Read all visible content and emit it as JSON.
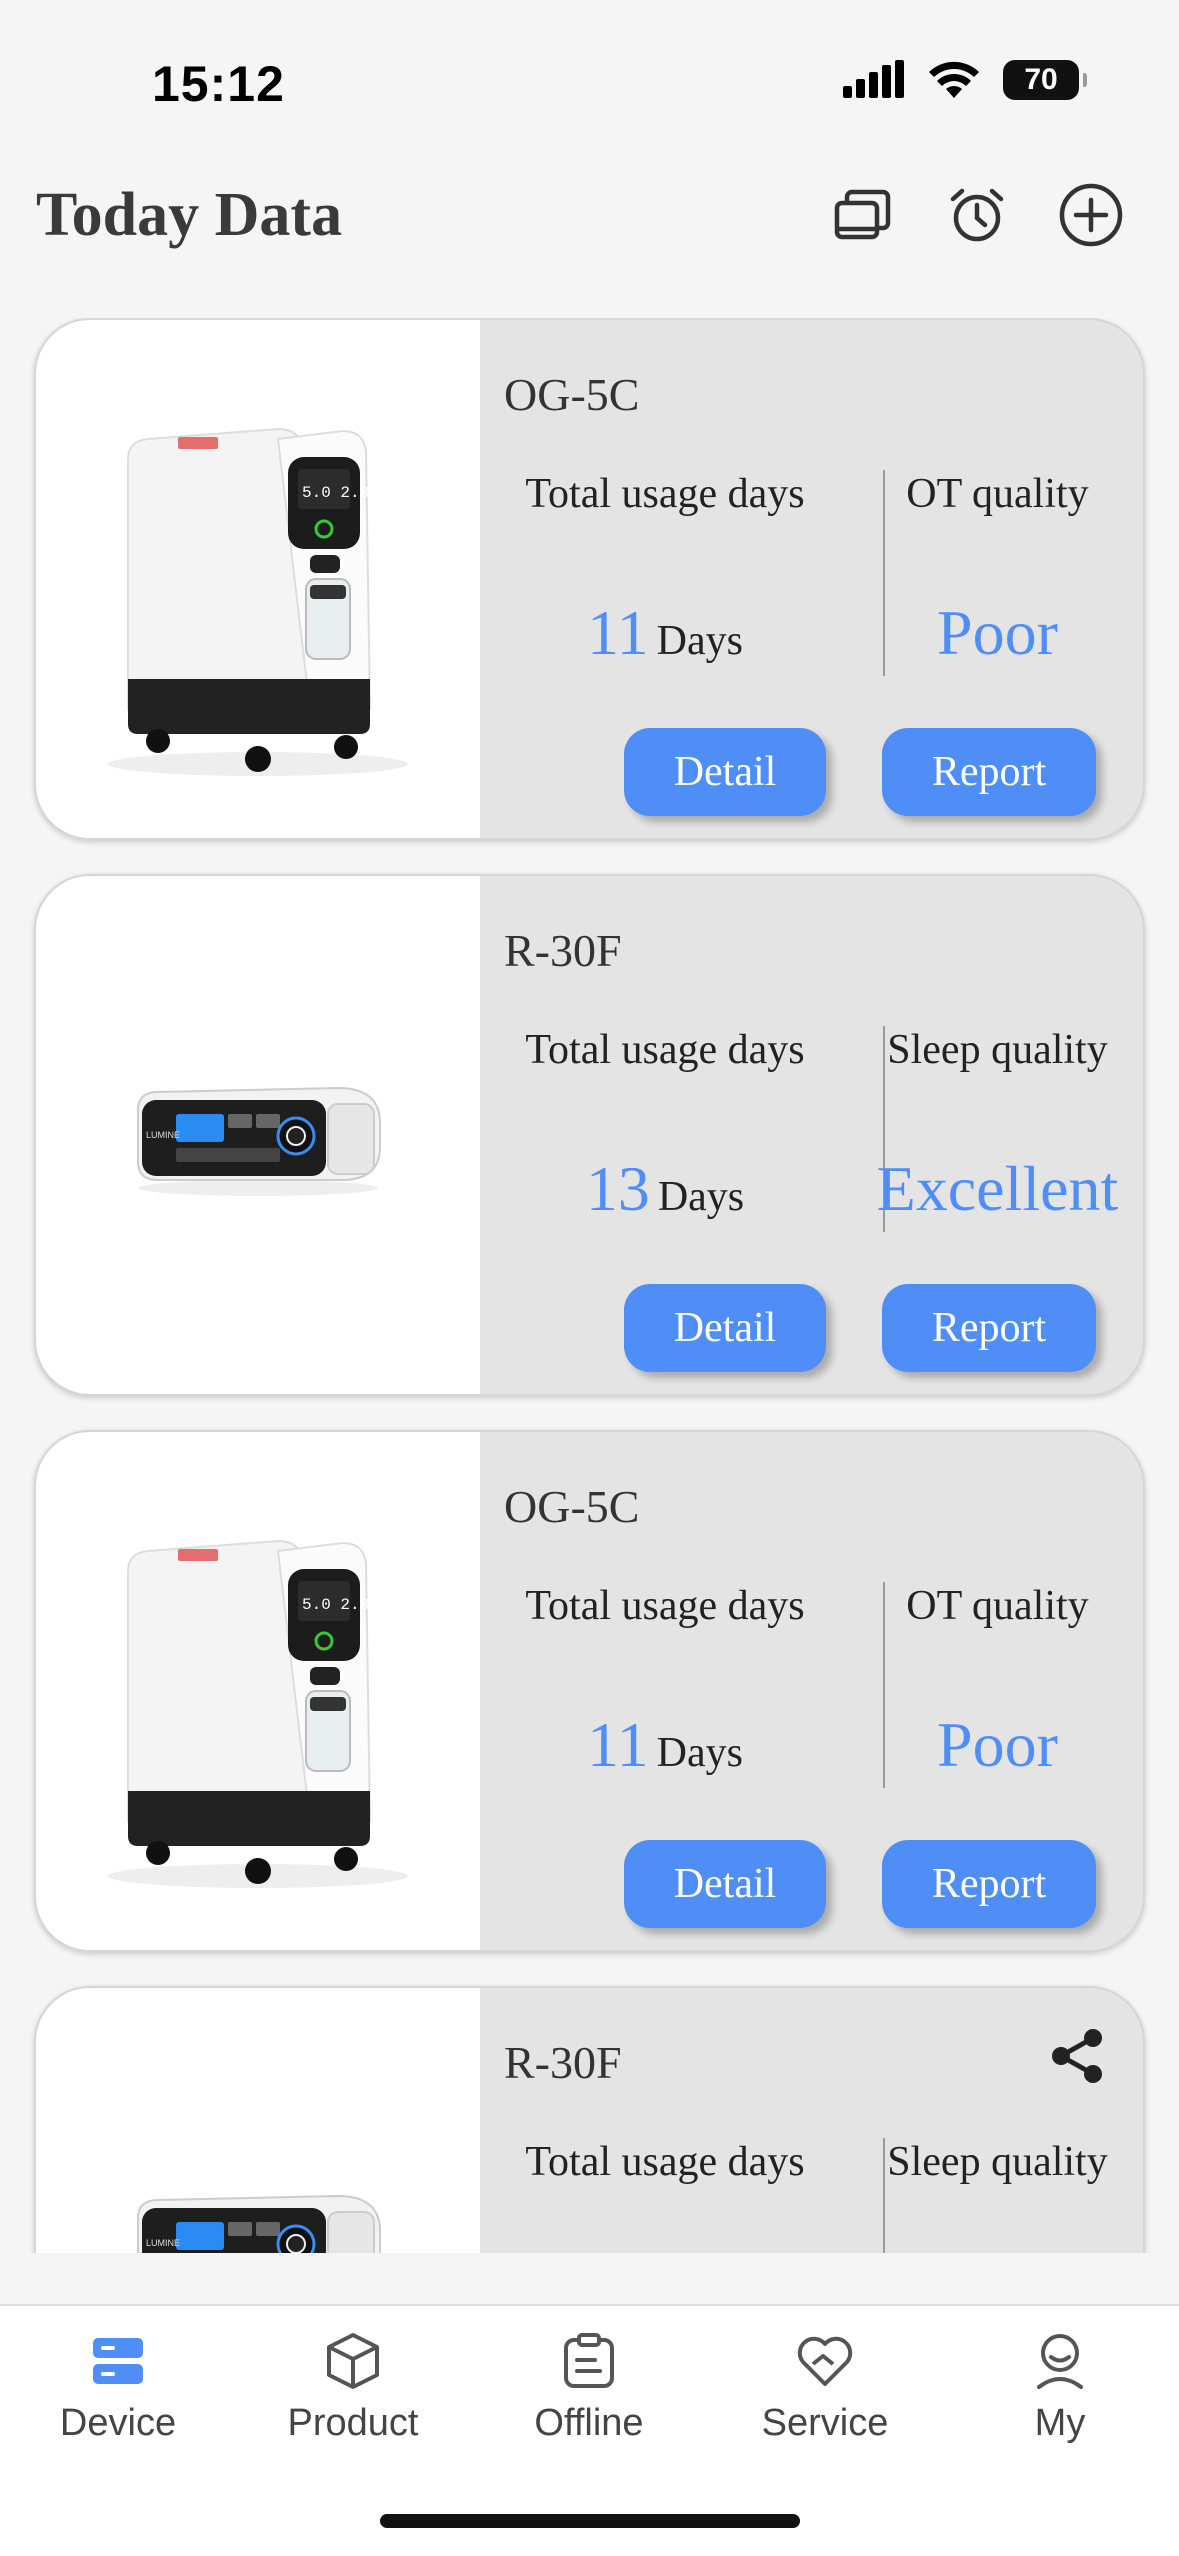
{
  "status": {
    "time": "15:12",
    "battery": "70"
  },
  "header": {
    "title": "Today Data"
  },
  "cards": [
    {
      "model": "OG-5C",
      "usage_label": "Total usage days",
      "quality_label": "OT quality",
      "days": "11",
      "days_unit": "Days",
      "quality": "Poor",
      "detail": "Detail",
      "report": "Report",
      "device": "oxygen-concentrator"
    },
    {
      "model": "R-30F",
      "usage_label": "Total usage days",
      "quality_label": "Sleep quality",
      "days": "13",
      "days_unit": "Days",
      "quality": "Excellent",
      "detail": "Detail",
      "report": "Report",
      "device": "cpap"
    },
    {
      "model": "OG-5C",
      "usage_label": "Total usage days",
      "quality_label": "OT quality",
      "days": "11",
      "days_unit": "Days",
      "quality": "Poor",
      "detail": "Detail",
      "report": "Report",
      "device": "oxygen-concentrator"
    },
    {
      "model": "R-30F",
      "usage_label": "Total usage days",
      "quality_label": "Sleep quality",
      "device": "cpap"
    }
  ],
  "tabs": [
    {
      "label": "Device",
      "icon": "device-icon",
      "active": true
    },
    {
      "label": "Product",
      "icon": "box-icon"
    },
    {
      "label": "Offline",
      "icon": "clipboard-icon"
    },
    {
      "label": "Service",
      "icon": "heart-icon"
    },
    {
      "label": "My",
      "icon": "user-icon"
    }
  ],
  "colors": {
    "accent": "#4f8ef7",
    "card_bg": "#e4e4e4",
    "page_bg": "#f5f5f5"
  }
}
